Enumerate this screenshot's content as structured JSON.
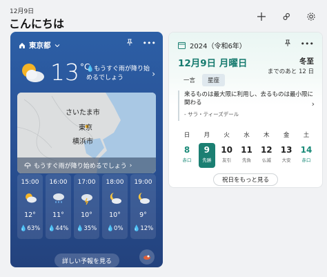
{
  "header": {
    "date": "12月9日",
    "greeting": "こんにちは"
  },
  "icons": {
    "add": "plus-icon",
    "people": "people-icon",
    "settings": "gear-icon"
  },
  "weather": {
    "location": "東京都",
    "current_temp": "13",
    "unit": "°C",
    "message": "もうすぐ雨が降り始めるでしょう",
    "map_labels": {
      "saitama": "さいたま市",
      "tokyo": "東京",
      "yokohama": "横浜市"
    },
    "map_banner": "もうすぐ雨が降り始めるでしょう",
    "hours": [
      {
        "time": "15:00",
        "temp": "12°",
        "precip": "63%",
        "icon": "cloud-sun-rain-icon"
      },
      {
        "time": "16:00",
        "temp": "11°",
        "precip": "44%",
        "icon": "rain-icon"
      },
      {
        "time": "17:00",
        "temp": "10°",
        "precip": "35%",
        "icon": "storm-icon"
      },
      {
        "time": "18:00",
        "temp": "10°",
        "precip": "0%",
        "icon": "moon-cloud-icon"
      },
      {
        "time": "19:00",
        "temp": "9°",
        "precip": "12%",
        "icon": "moon-cloud-icon"
      }
    ],
    "forecast_button": "詳しい予報を見る"
  },
  "calendar": {
    "year_label": "2024（令和6年）",
    "date_label": "12月9日 月曜日",
    "solar_term": "冬至",
    "solar_days": "までのあと 12 日",
    "tabs": [
      "一言",
      "星座"
    ],
    "quote": "来るものは最大限に利用し、去るものは最小限に関わる",
    "quote_author": "- サラ・ティーズデール",
    "days": [
      {
        "dow": "日",
        "num": "8",
        "rokuyo": "赤口",
        "style": "green"
      },
      {
        "dow": "月",
        "num": "9",
        "rokuyo": "先勝",
        "style": "today"
      },
      {
        "dow": "火",
        "num": "10",
        "rokuyo": "友引",
        "style": "normal"
      },
      {
        "dow": "水",
        "num": "11",
        "rokuyo": "先負",
        "style": "normal"
      },
      {
        "dow": "木",
        "num": "12",
        "rokuyo": "仏滅",
        "style": "normal"
      },
      {
        "dow": "金",
        "num": "13",
        "rokuyo": "大安",
        "style": "normal"
      },
      {
        "dow": "土",
        "num": "14",
        "rokuyo": "赤口",
        "style": "green"
      }
    ],
    "more_button": "祝日をもっと見る"
  },
  "colors": {
    "accent": "#1b7f72",
    "weather_bg": "#2a5296"
  }
}
